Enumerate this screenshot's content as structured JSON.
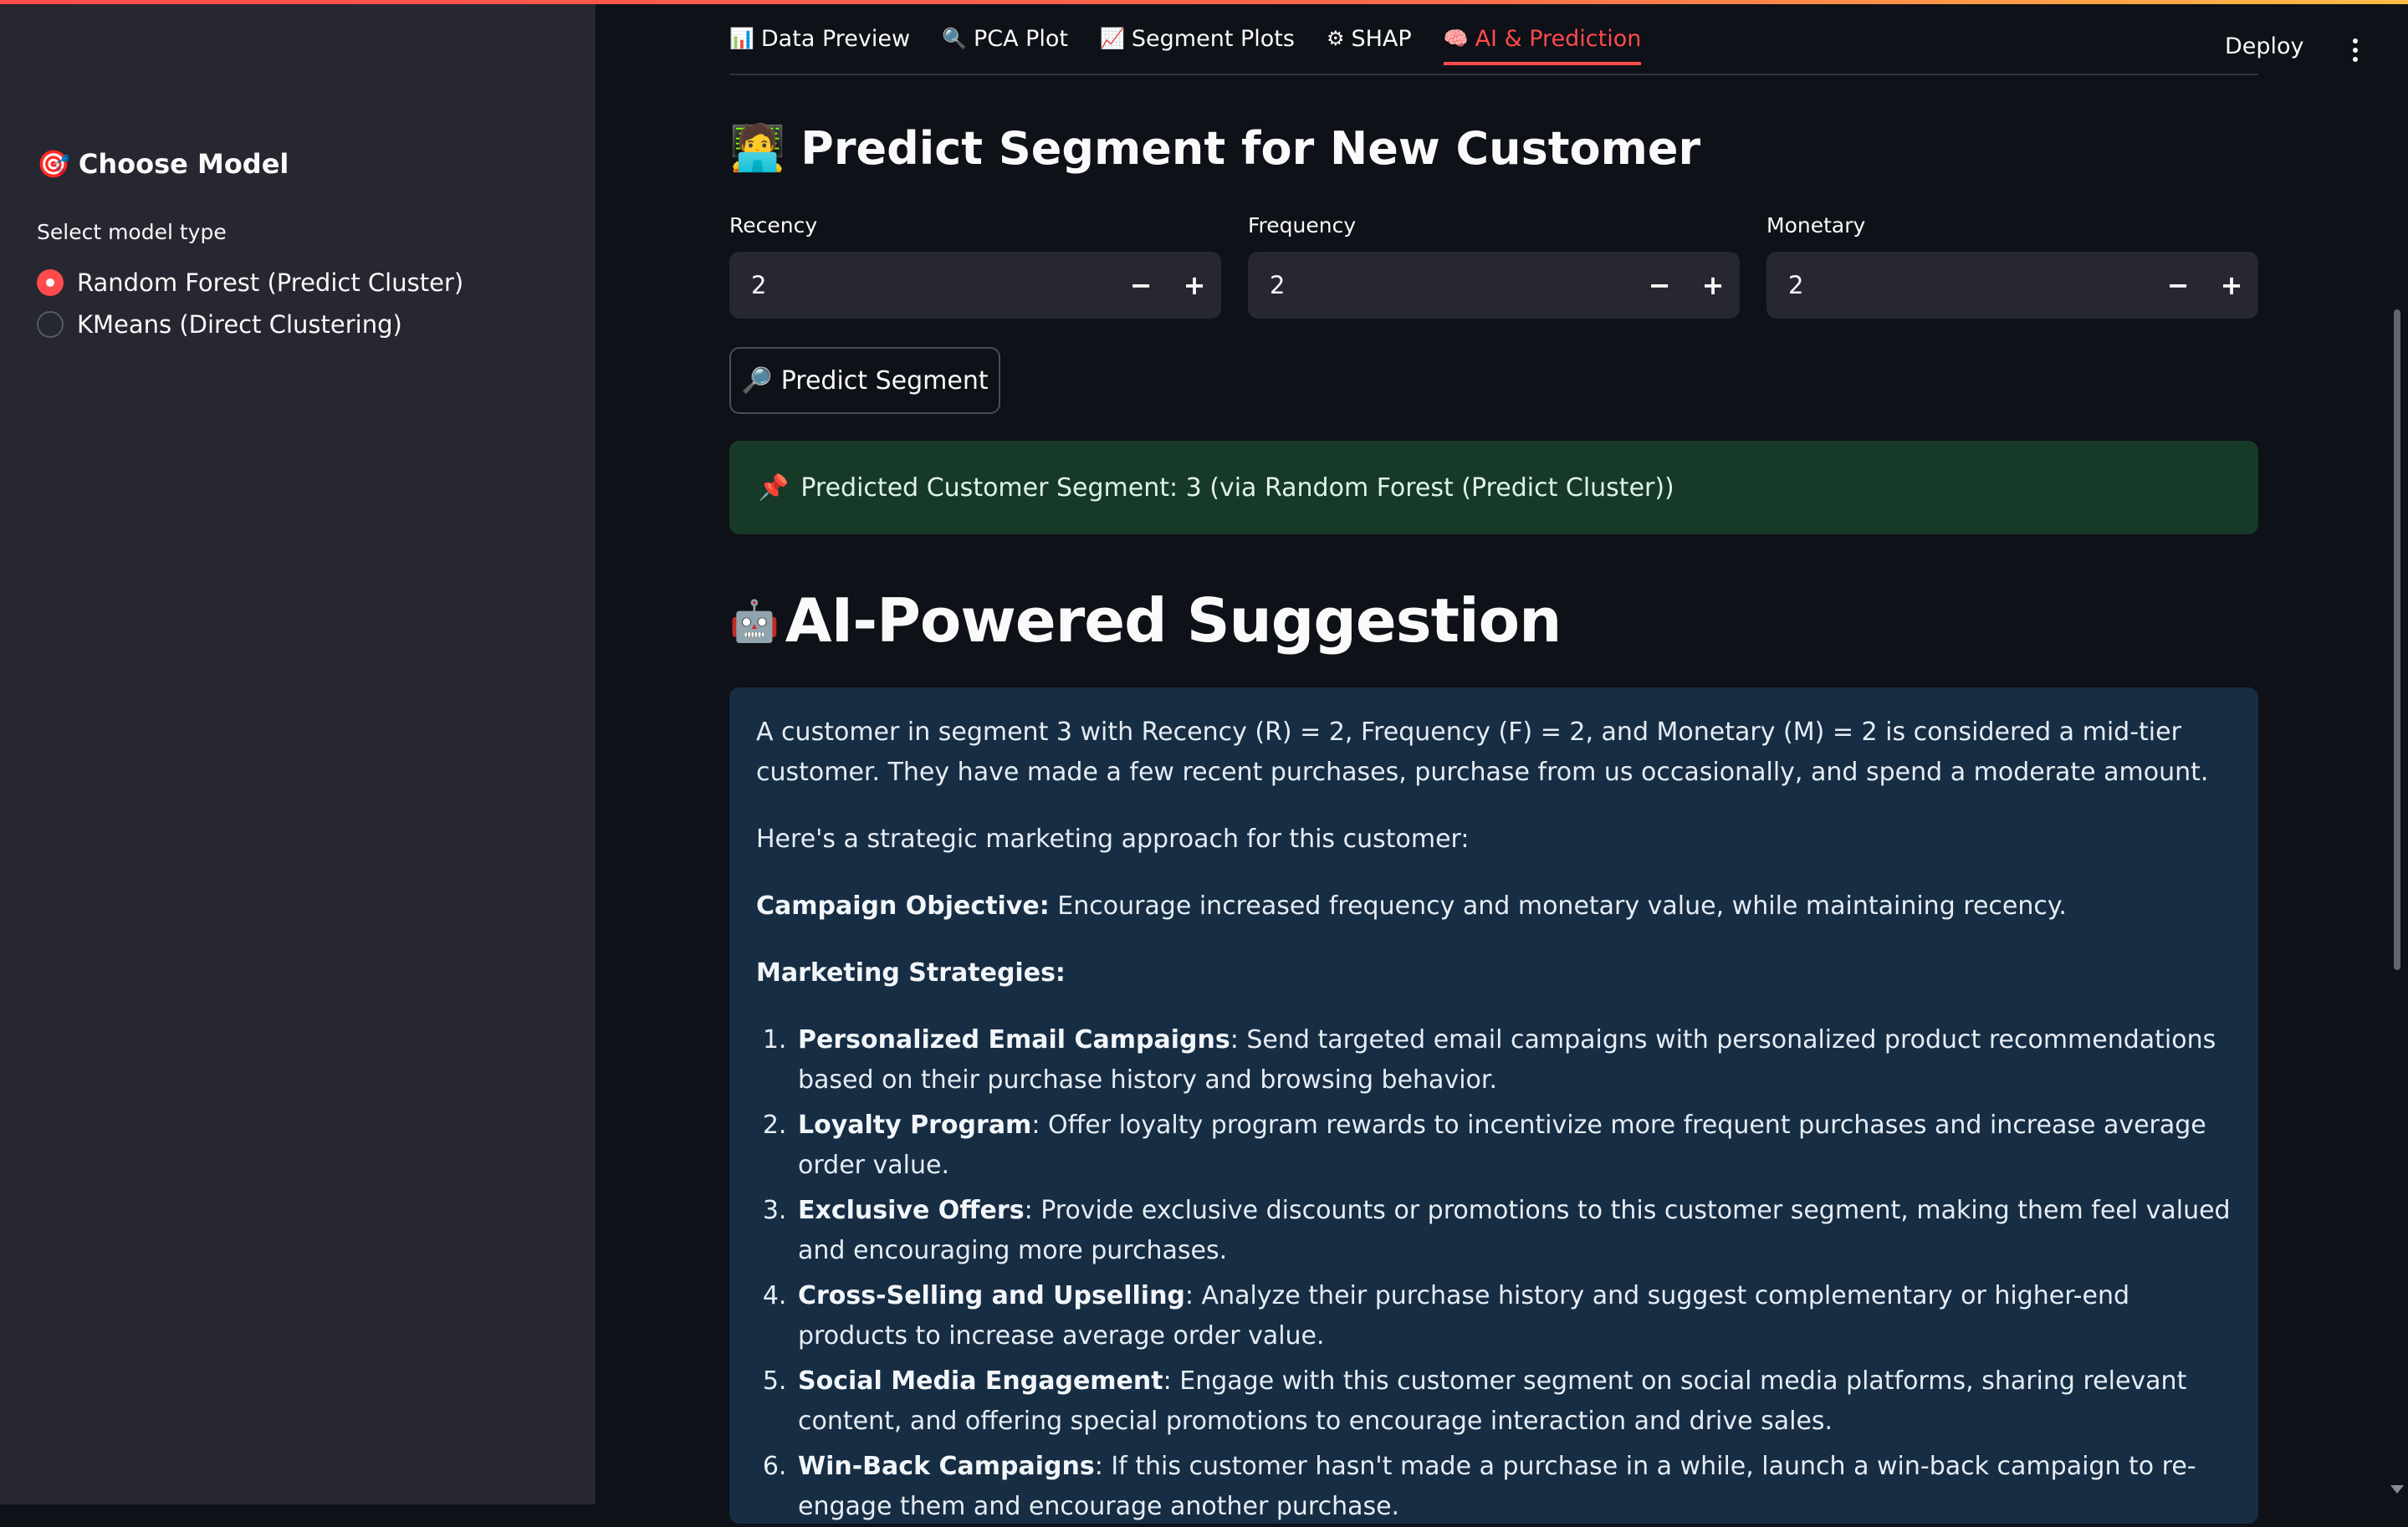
{
  "sidebar": {
    "header_icon": "🎯",
    "header": "Choose Model",
    "label": "Select model type",
    "options": [
      {
        "label": "Random Forest (Predict Cluster)",
        "selected": true
      },
      {
        "label": "KMeans (Direct Clustering)",
        "selected": false
      }
    ]
  },
  "topbar": {
    "deploy": "Deploy"
  },
  "tabs": [
    {
      "icon": "📊",
      "label": "Data Preview"
    },
    {
      "icon": "🔍",
      "label": "PCA Plot"
    },
    {
      "icon": "📈",
      "label": "Segment Plots"
    },
    {
      "icon": "⚙",
      "label": "SHAP"
    },
    {
      "icon": "🧠",
      "label": "AI & Prediction",
      "active": true
    }
  ],
  "predict": {
    "title_icon": "🧑‍💻",
    "title": "Predict Segment for New Customer",
    "fields": [
      {
        "label": "Recency",
        "value": "2"
      },
      {
        "label": "Frequency",
        "value": "2"
      },
      {
        "label": "Monetary",
        "value": "2"
      }
    ],
    "button_icon": "🔎",
    "button": "Predict Segment",
    "result_icon": "📌",
    "result": "Predicted Customer Segment: 3 (via Random Forest (Predict Cluster))"
  },
  "suggestion": {
    "title_icon": "🤖",
    "title": "AI-Powered Suggestion",
    "intro": "A customer in segment 3 with Recency (R) = 2, Frequency (F) = 2, and Monetary (M) = 2 is considered a mid-tier customer. They have made a few recent purchases, purchase from us occasionally, and spend a moderate amount.",
    "approach": "Here's a strategic marketing approach for this customer:",
    "objective_label": "Campaign Objective:",
    "objective": " Encourage increased frequency and monetary value, while maintaining recency.",
    "strategies_label": "Marketing Strategies:",
    "strategies": [
      {
        "title": "Personalized Email Campaigns",
        "text": ": Send targeted email campaigns with personalized product recommendations based on their purchase history and browsing behavior."
      },
      {
        "title": "Loyalty Program",
        "text": ": Offer loyalty program rewards to incentivize more frequent purchases and increase average order value."
      },
      {
        "title": "Exclusive Offers",
        "text": ": Provide exclusive discounts or promotions to this customer segment, making them feel valued and encouraging more purchases."
      },
      {
        "title": "Cross-Selling and Upselling",
        "text": ": Analyze their purchase history and suggest complementary or higher-end products to increase average order value."
      },
      {
        "title": "Social Media Engagement",
        "text": ": Engage with this customer segment on social media platforms, sharing relevant content, and offering special promotions to encourage interaction and drive sales."
      },
      {
        "title": "Win-Back Campaigns",
        "text": ": If this customer hasn't made a purchase in a while, launch a win-back campaign to re-engage them and encourage another purchase."
      }
    ]
  }
}
